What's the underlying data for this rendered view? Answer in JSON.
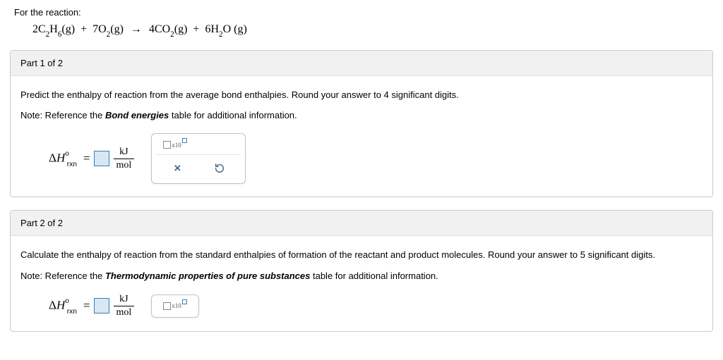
{
  "intro": {
    "prefix": "For the reaction:",
    "equation": {
      "lhs": [
        {
          "coef": "2",
          "formula": "C",
          "sub1": "2",
          "mid": "H",
          "sub2": "6",
          "phase": "(g)"
        },
        {
          "coef": "7",
          "formula": "O",
          "sub1": "2",
          "mid": "",
          "sub2": "",
          "phase": "(g)"
        }
      ],
      "rhs": [
        {
          "coef": "4",
          "formula": "CO",
          "sub1": "2",
          "mid": "",
          "sub2": "",
          "phase": "(g)"
        },
        {
          "coef": "6",
          "formula": "H",
          "sub1": "2",
          "mid": "O",
          "sub2": "",
          "phase": "(g)"
        }
      ]
    }
  },
  "parts": [
    {
      "header": "Part 1 of 2",
      "prompt_html": "Predict the enthalpy of reaction from the average bond enthalpies. Round your answer to 4 significant digits.",
      "note_plain": "Note: Reference the ",
      "note_bold": "Bond energies",
      "note_tail": " table for additional information.",
      "symbol": {
        "dH": "Δ",
        "H": "H",
        "super": "o",
        "sub": "rxn",
        "eq": "="
      },
      "unit": {
        "top": "kJ",
        "bot": "mol"
      },
      "show_tool_row2": true
    },
    {
      "header": "Part 2 of 2",
      "prompt_html": "Calculate the enthalpy of reaction from the standard enthalpies of formation of the reactant and product molecules. Round your answer to 5 significant digits.",
      "note_plain": "Note: Reference the ",
      "note_bold": "Thermodynamic properties of pure substances",
      "note_tail": " table for additional information.",
      "symbol": {
        "dH": "Δ",
        "H": "H",
        "super": "o",
        "sub": "rxn",
        "eq": "="
      },
      "unit": {
        "top": "kJ",
        "bot": "mol"
      },
      "show_tool_row2": false
    }
  ],
  "tools": {
    "x10": "x10",
    "clear": "×",
    "undo": "↺"
  }
}
